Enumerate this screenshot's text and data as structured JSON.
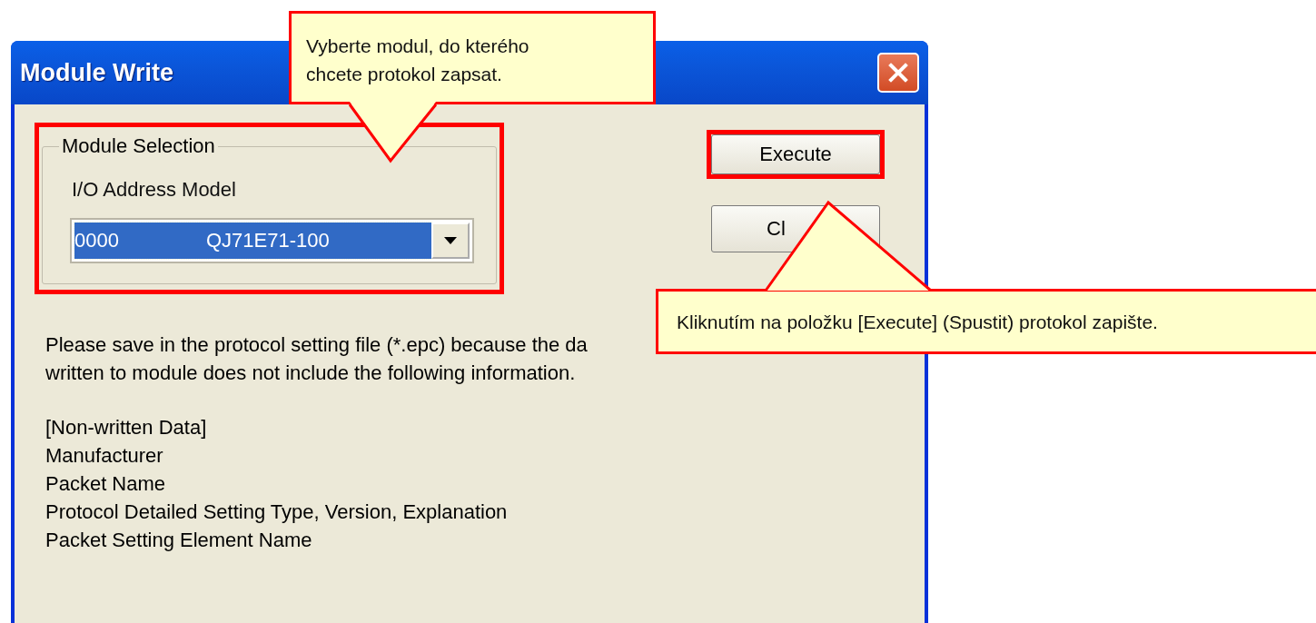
{
  "window": {
    "title": "Module Write"
  },
  "module_selection": {
    "title": "Module Selection",
    "label": "I/O Address Model",
    "highlighted": true,
    "dropdown": {
      "address": "0000",
      "model": "QJ71E71-100",
      "selected": true
    }
  },
  "buttons": [
    {
      "label": "Execute",
      "highlighted": true
    },
    {
      "label": "Cl",
      "highlighted": false
    }
  ],
  "message": [
    "Please save in the protocol setting file (*.epc) because the da",
    "written to module does not include the following information."
  ],
  "non_written": {
    "heading": "[Non-written Data]",
    "items": [
      "Manufacturer",
      "Packet Name",
      "Protocol Detailed Setting Type, Version, Explanation",
      "Packet Setting Element Name"
    ]
  },
  "callouts": [
    {
      "lines": [
        "Vyberte modul, do kterého",
        "chcete protokol zapsat."
      ]
    },
    {
      "lines": [
        "Kliknutím na položku [Execute] (Spustit) protokol zapište."
      ]
    }
  ]
}
